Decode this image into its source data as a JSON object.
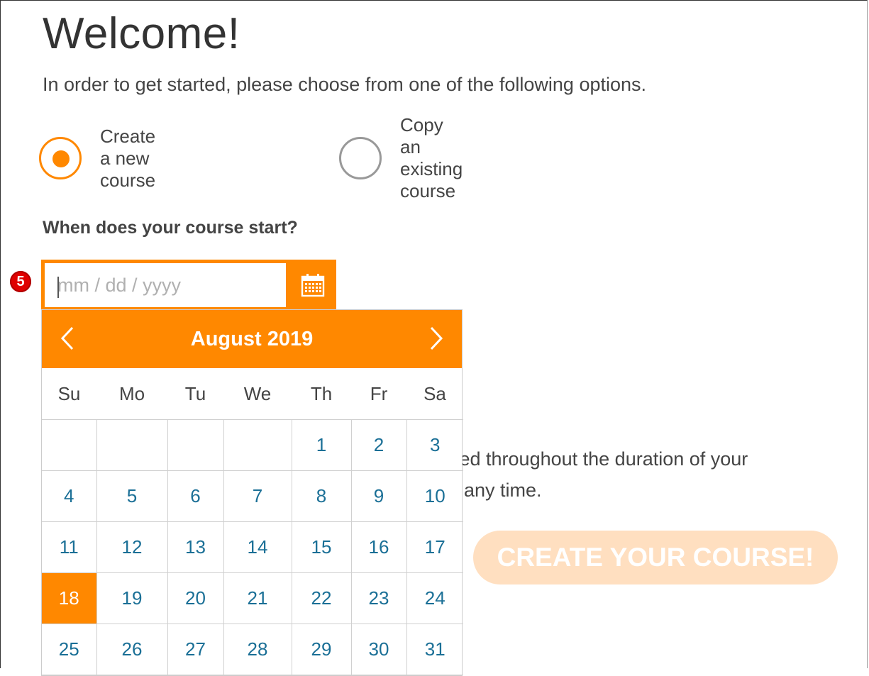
{
  "page": {
    "title": "Welcome!",
    "subtitle": "In order to get started, please choose from one of the following options."
  },
  "course_options": [
    {
      "label": "Create a new course",
      "selected": true
    },
    {
      "label": "Copy an existing course",
      "selected": false
    }
  ],
  "start_date": {
    "question": "When does your course start?",
    "placeholder": "mm / dd / yyyy",
    "step_badge": "5"
  },
  "calendar": {
    "month_label": "August 2019",
    "weekdays": [
      "Su",
      "Mo",
      "Tu",
      "We",
      "Th",
      "Fr",
      "Sa"
    ],
    "weeks": [
      [
        "",
        "",
        "",
        "",
        "1",
        "2",
        "3"
      ],
      [
        "4",
        "5",
        "6",
        "7",
        "8",
        "9",
        "10"
      ],
      [
        "11",
        "12",
        "13",
        "14",
        "15",
        "16",
        "17"
      ],
      [
        "18",
        "19",
        "20",
        "21",
        "22",
        "23",
        "24"
      ],
      [
        "25",
        "26",
        "27",
        "28",
        "29",
        "30",
        "31"
      ]
    ],
    "selected_day": "18"
  },
  "partially_hidden_text": {
    "line1": "ted throughout the duration of your",
    "line2": "any time."
  },
  "create_button_label": "CREATE YOUR COURSE!",
  "colors": {
    "accent": "#ff8800",
    "day_text": "#1a6f96",
    "button_disabled": "#ffdfc0",
    "badge": "#e00000"
  },
  "icons": {
    "calendar": "calendar-icon",
    "prev": "chevron-left-icon",
    "next": "chevron-right-icon"
  }
}
